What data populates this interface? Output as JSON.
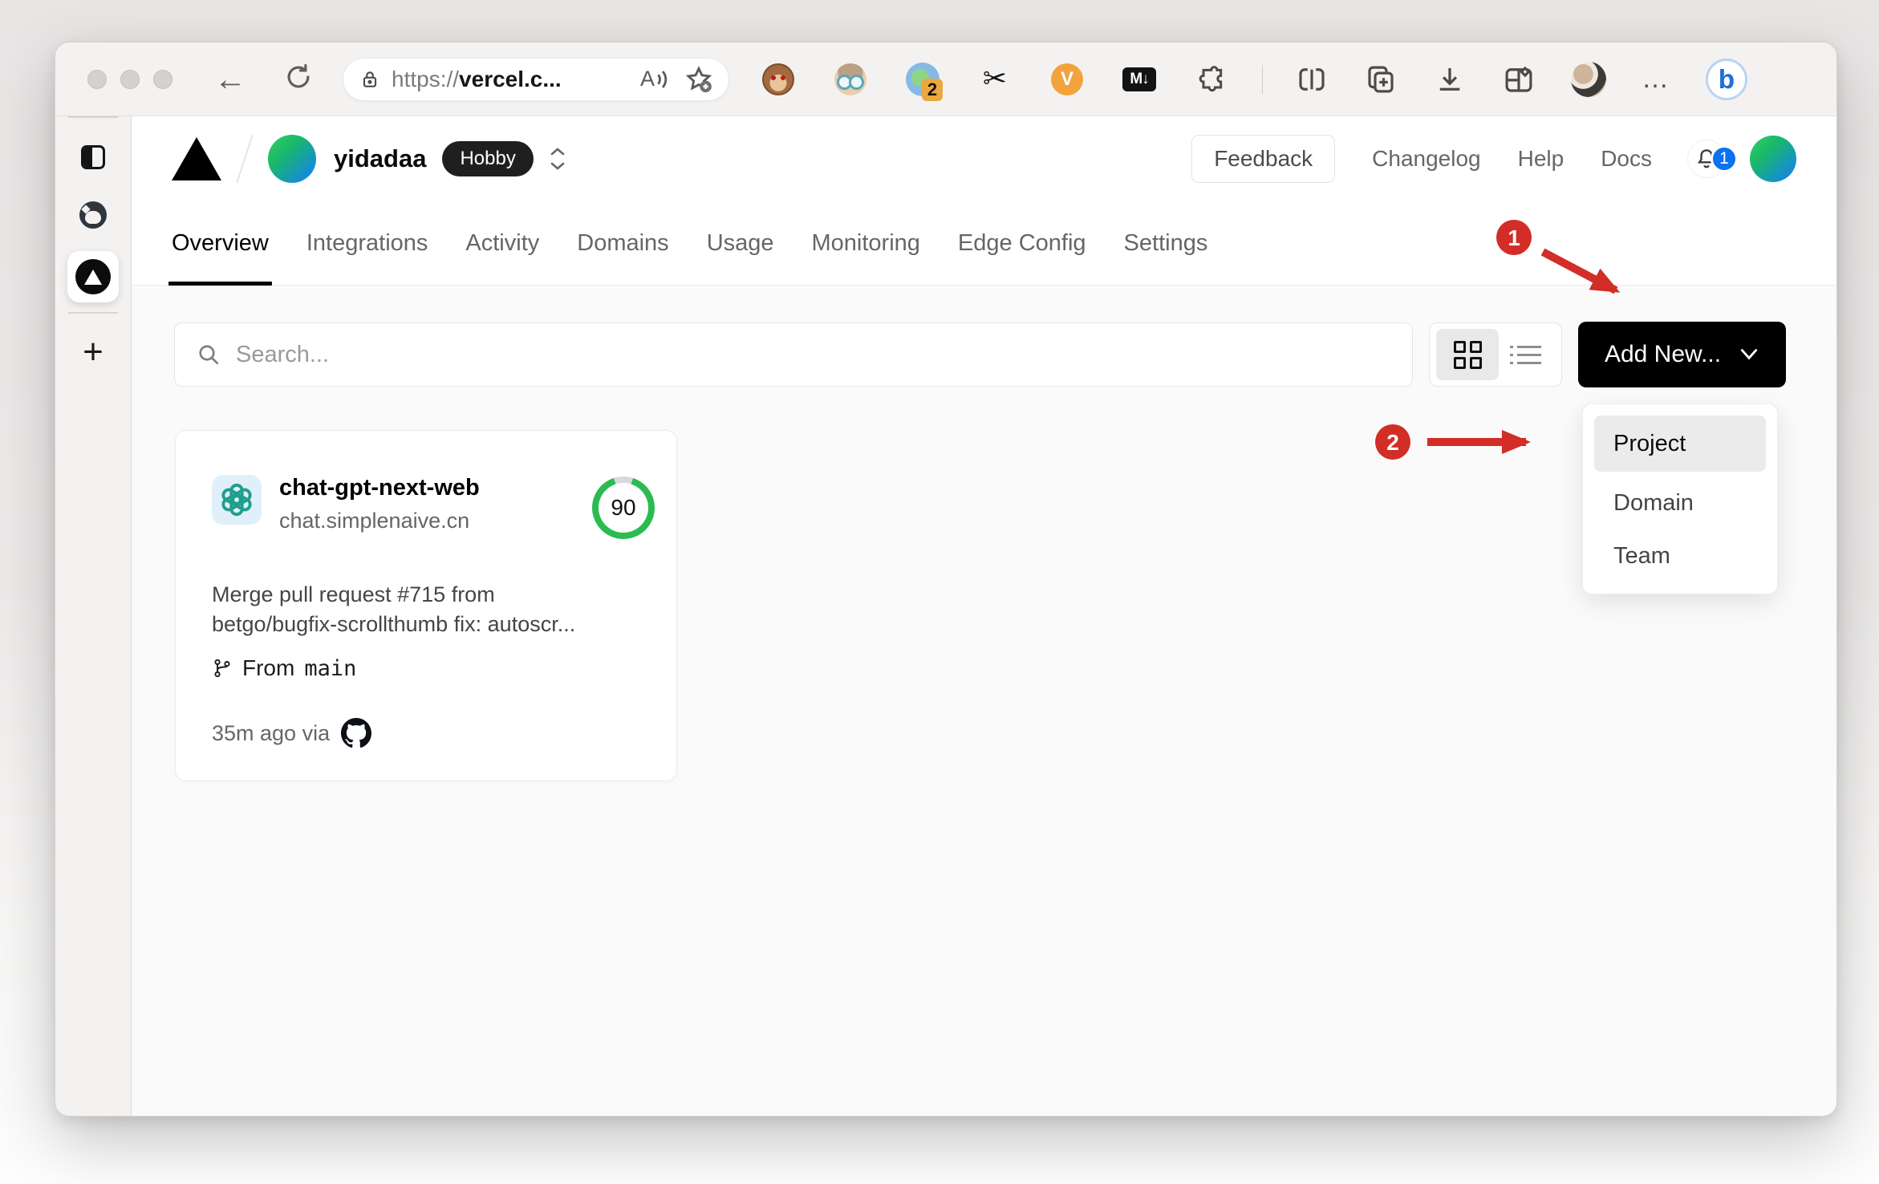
{
  "colors": {
    "accent_red": "#d22d26",
    "vercel_green": "#2bbc4f",
    "notification_blue": "#0b72f0",
    "openai_teal": "#1f9e8c",
    "button_black": "#000000"
  },
  "browser": {
    "back_glyph": "←",
    "url": {
      "scheme": "https://",
      "host": "vercel.c..."
    },
    "read_aloud_glyph": "A",
    "tab_group_badge": "2",
    "v_extension_label": "V",
    "markdown_extension_label": "M↓",
    "menu_dots": "…",
    "bing_glyph": "b",
    "scissors_glyph": "✂",
    "new_tab_glyph": "+"
  },
  "vercel": {
    "header": {
      "team_name": "yidadaa",
      "plan_badge": "Hobby",
      "feedback_label": "Feedback",
      "links": [
        "Changelog",
        "Help",
        "Docs"
      ],
      "notification_count": "1"
    },
    "tabs": [
      "Overview",
      "Integrations",
      "Activity",
      "Domains",
      "Usage",
      "Monitoring",
      "Edge Config",
      "Settings"
    ],
    "toolbar": {
      "search_placeholder": "Search...",
      "add_new_label": "Add New..."
    },
    "dropdown": {
      "items": [
        "Project",
        "Domain",
        "Team"
      ]
    },
    "project_card": {
      "name": "chat-gpt-next-web",
      "domain": "chat.simplenaive.cn",
      "score": "90",
      "commit_line1": "Merge pull request #715 from",
      "commit_line2": "betgo/bugfix-scrollthumb fix: autoscr...",
      "branch_prefix": "From",
      "branch_name": "main",
      "deploy_meta": "35m ago via"
    }
  },
  "annotations": {
    "step1": "1",
    "step2": "2"
  }
}
